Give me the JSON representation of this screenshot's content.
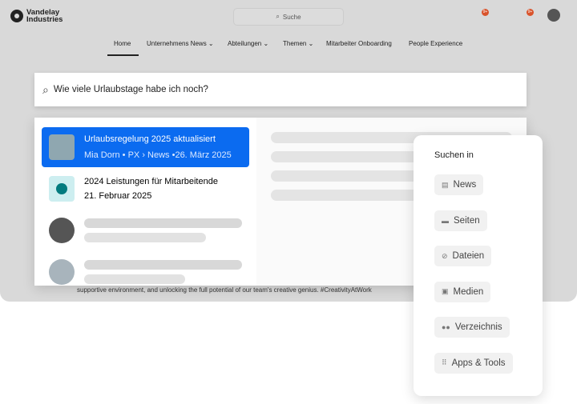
{
  "header": {
    "brand": "Vandelay Industries",
    "search_placeholder": "Suche",
    "badge1": "9+",
    "badge2": "9+",
    "avatar_count": "1"
  },
  "nav": [
    "Home",
    "Unternehmens News ⌄",
    "Abteilungen ⌄",
    "Themen ⌄",
    "Mitarbeiter Onboarding",
    "People Experience"
  ],
  "search": {
    "query": "Wie viele Urlaubstage habe ich noch?"
  },
  "results": [
    {
      "title": "Urlaubsregelung 2025 aktualisiert",
      "meta": "Mia Dorn • PX › News •26. März 2025"
    },
    {
      "title": "2024 Leistungen für Mitarbeitende",
      "meta": "21. Februar 2025"
    }
  ],
  "footer_text": "supportive environment, and unlocking the full potential of our team's creative genius. #CreativityAtWork",
  "scope": {
    "title": "Suchen in",
    "options": [
      {
        "label": "News",
        "icon": "newspaper-icon"
      },
      {
        "label": "Seiten",
        "icon": "page-icon"
      },
      {
        "label": "Dateien",
        "icon": "paperclip-icon"
      },
      {
        "label": "Medien",
        "icon": "image-icon"
      },
      {
        "label": "Verzeichnis",
        "icon": "people-icon"
      },
      {
        "label": "Apps & Tools",
        "icon": "grid-icon"
      }
    ]
  },
  "colors": {
    "accent": "#0b6bf0",
    "badge": "#d9532b"
  }
}
